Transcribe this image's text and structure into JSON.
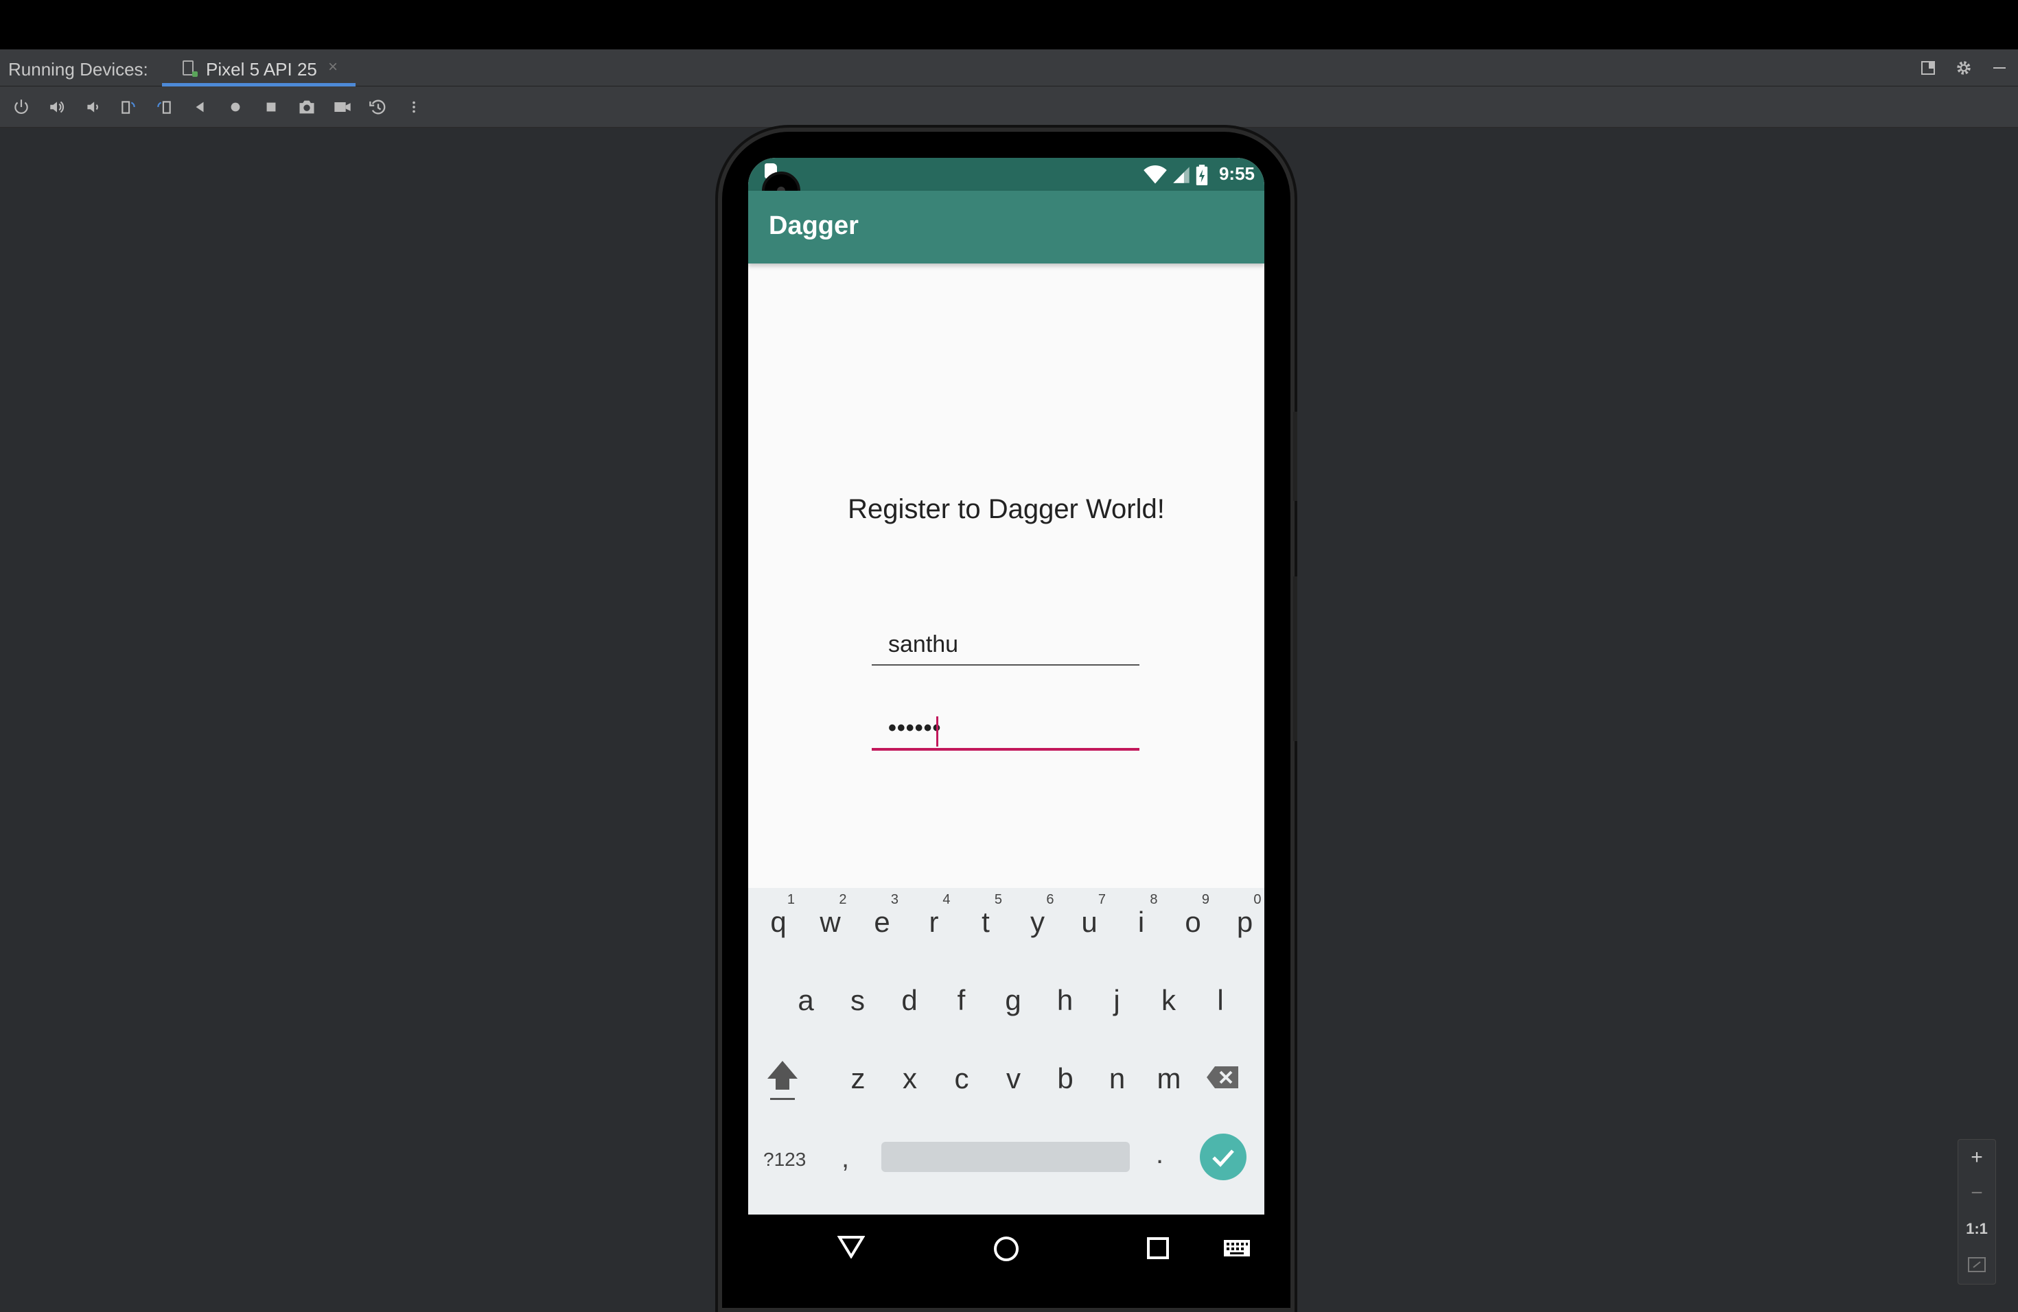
{
  "ide": {
    "panel_label": "Running Devices:",
    "device_tab": "Pixel 5 API 25",
    "close_glyph": "×"
  },
  "device": {
    "status_time": "9:55",
    "app_title": "Dagger",
    "heading": "Register to Dagger World!",
    "username_value": "santhu",
    "password_value": "••••••"
  },
  "keyboard": {
    "row1": [
      {
        "ch": "q",
        "hint": "1"
      },
      {
        "ch": "w",
        "hint": "2"
      },
      {
        "ch": "e",
        "hint": "3"
      },
      {
        "ch": "r",
        "hint": "4"
      },
      {
        "ch": "t",
        "hint": "5"
      },
      {
        "ch": "y",
        "hint": "6"
      },
      {
        "ch": "u",
        "hint": "7"
      },
      {
        "ch": "i",
        "hint": "8"
      },
      {
        "ch": "o",
        "hint": "9"
      },
      {
        "ch": "p",
        "hint": "0"
      }
    ],
    "row2": [
      "a",
      "s",
      "d",
      "f",
      "g",
      "h",
      "j",
      "k",
      "l"
    ],
    "row3": [
      "z",
      "x",
      "c",
      "v",
      "b",
      "n",
      "m"
    ],
    "symbols_label": "?123",
    "comma": ",",
    "period": "."
  },
  "zoom": {
    "zoom_in": "+",
    "zoom_out": "−",
    "actual_size": "1:1"
  },
  "colors": {
    "status_bar": "#27695d",
    "app_bar": "#3a8477",
    "accent": "#c2185b",
    "enter_key": "#4db6ac"
  }
}
